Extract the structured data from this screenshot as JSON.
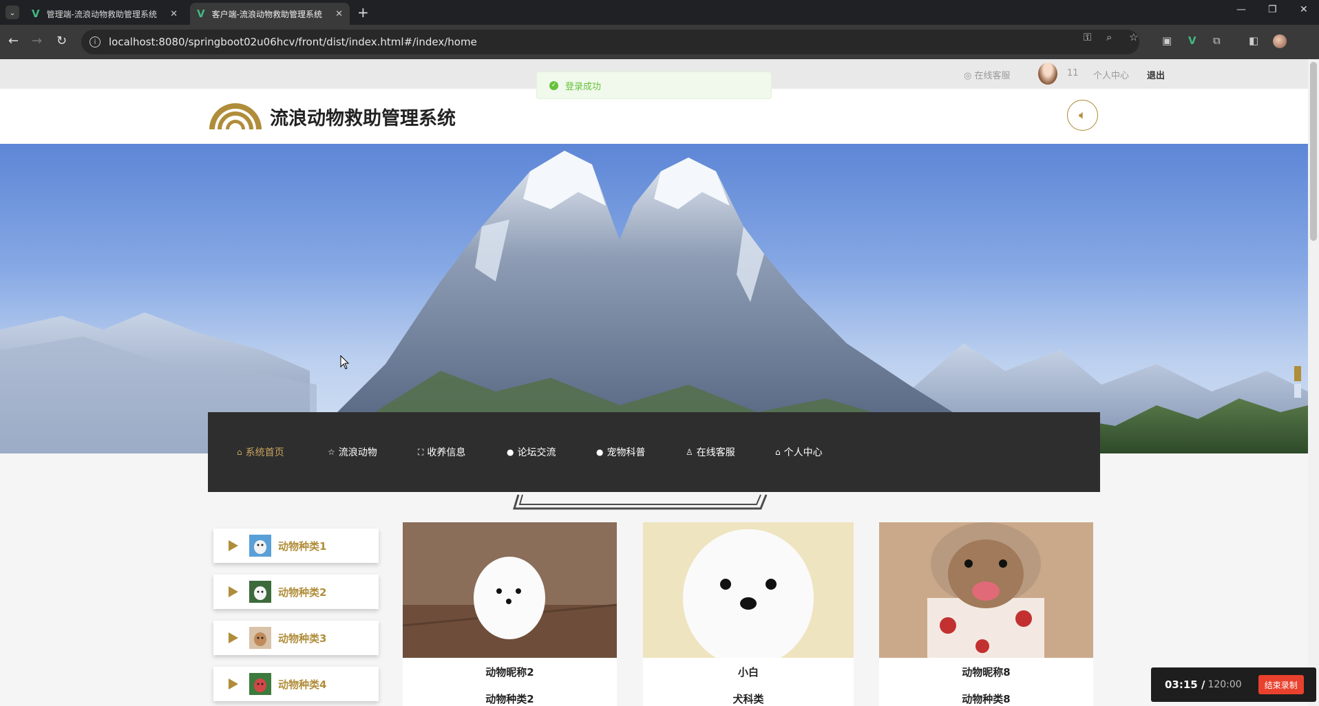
{
  "browser": {
    "tabs": [
      {
        "title": "管理端-流浪动物救助管理系统",
        "active": false
      },
      {
        "title": "客户端-流浪动物救助管理系统",
        "active": true
      }
    ],
    "url": "localhost:8080/springboot02u06hcv/front/dist/index.html#/index/home"
  },
  "topbar": {
    "service": "在线客服",
    "username": "11",
    "personal_center": "个人中心",
    "logout": "退出"
  },
  "toast": {
    "message": "登录成功"
  },
  "header": {
    "site_title": "流浪动物救助管理系统"
  },
  "nav": {
    "items": [
      {
        "label": "系统首页",
        "icon": "home-icon",
        "active": true
      },
      {
        "label": "流浪动物",
        "icon": "star-icon",
        "active": false
      },
      {
        "label": "收养信息",
        "icon": "bag-icon",
        "active": false
      },
      {
        "label": "论坛交流",
        "icon": "info-icon",
        "active": false
      },
      {
        "label": "宠物科普",
        "icon": "question-icon",
        "active": false
      },
      {
        "label": "在线客服",
        "icon": "user-icon",
        "active": false
      },
      {
        "label": "个人中心",
        "icon": "house-icon",
        "active": false
      }
    ]
  },
  "sidebar": {
    "items": [
      {
        "label": "动物种类1"
      },
      {
        "label": "动物种类2"
      },
      {
        "label": "动物种类3"
      },
      {
        "label": "动物种类4"
      }
    ]
  },
  "cards": [
    {
      "name": "动物昵称2",
      "type": "动物种类2"
    },
    {
      "name": "小白",
      "type": "犬科类"
    },
    {
      "name": "动物昵称8",
      "type": "动物种类8"
    }
  ],
  "recorder": {
    "elapsed": "03:15 /",
    "total": "120:00",
    "stop_label": "结束录制"
  },
  "colors": {
    "accent": "#b08d3a",
    "nav_bg": "#2e2e2e",
    "success": "#67c23a",
    "record_red": "#e9412d"
  }
}
